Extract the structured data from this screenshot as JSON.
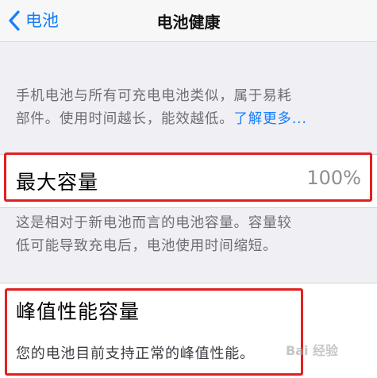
{
  "navbar": {
    "back_label": "电池",
    "title": "电池健康"
  },
  "battery_info": {
    "line1": "手机电池与所有可充电电池类似，属于易耗",
    "line2_text": "部件。使用时间越长，能效越低。",
    "learn_more": "了解更多..."
  },
  "max_capacity": {
    "label": "最大容量",
    "value": "100%",
    "desc_line1": "这是相对于新电池而言的电池容量。容量较",
    "desc_line2": "低可能导致充电后，电池使用时间缩短。"
  },
  "peak_performance": {
    "label": "峰值性能容量",
    "desc": "您的电池目前支持正常的峰值性能。"
  },
  "watermark": "Bai 经验",
  "colors": {
    "accent": "#157efb",
    "highlight": "#e02020",
    "background": "#efeff4"
  }
}
